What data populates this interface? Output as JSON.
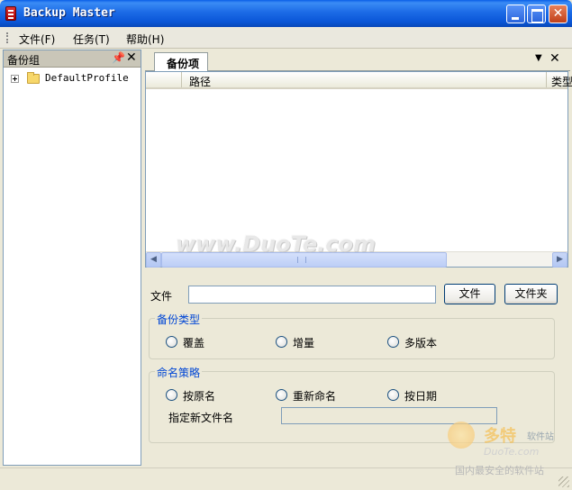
{
  "window": {
    "title": "Backup Master",
    "icon": "app-icon"
  },
  "menubar": {
    "items": [
      "文件(F)",
      "任务(T)",
      "帮助(H)"
    ]
  },
  "left_pane": {
    "title": "备份组",
    "tree": [
      {
        "label": "DefaultProfile",
        "icon": "folder-icon",
        "expanded": false
      }
    ]
  },
  "tabs": [
    {
      "label": "备份项",
      "active": true
    }
  ],
  "list": {
    "columns": [
      "",
      "路径",
      "类型"
    ]
  },
  "watermark": "www.DuoTe.com",
  "form": {
    "file_label": "文件",
    "file_value": "",
    "file_button": "文件",
    "folder_button": "文件夹",
    "backup_type": {
      "title": "备份类型",
      "options": [
        "覆盖",
        "增量",
        "多版本"
      ]
    },
    "naming": {
      "title": "命名策略",
      "options": [
        "按原名",
        "重新命名",
        "按日期"
      ],
      "new_name_label": "指定新文件名",
      "new_name_value": ""
    }
  },
  "site_watermark": {
    "brand": "多特",
    "tagline": "软件站",
    "site": "DuoTe.com",
    "slogan": "国内最安全的软件站"
  },
  "colors": {
    "titlebar": "#0a56d8",
    "group_title": "#0046d5",
    "face": "#ece9d8"
  }
}
